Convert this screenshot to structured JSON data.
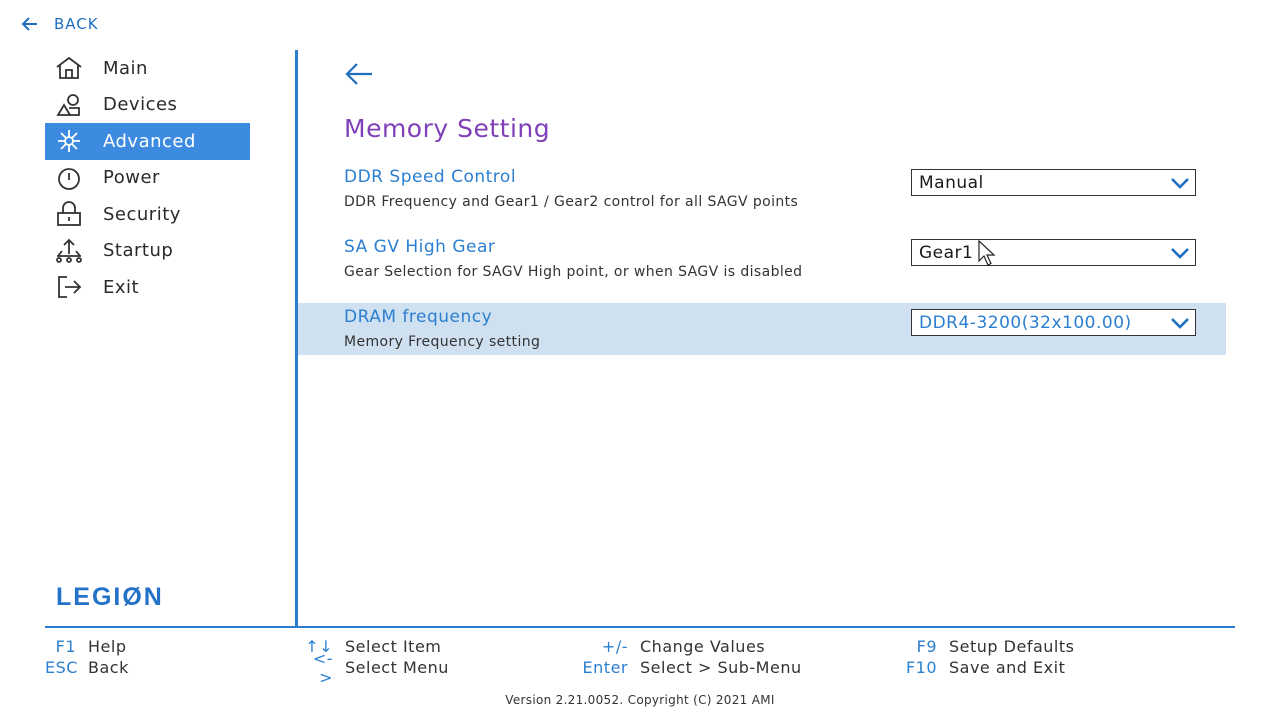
{
  "header": {
    "back_label": "BACK"
  },
  "sidebar": {
    "items": [
      {
        "label": "Main",
        "icon": "home-icon"
      },
      {
        "label": "Devices",
        "icon": "devices-icon"
      },
      {
        "label": "Advanced",
        "icon": "advanced-icon",
        "active": true
      },
      {
        "label": "Power",
        "icon": "power-icon"
      },
      {
        "label": "Security",
        "icon": "lock-icon"
      },
      {
        "label": "Startup",
        "icon": "startup-icon"
      },
      {
        "label": "Exit",
        "icon": "exit-icon"
      }
    ],
    "logo": "LEGIØN"
  },
  "main": {
    "title": "Memory Setting",
    "settings": [
      {
        "label": "DDR Speed Control",
        "description": "DDR Frequency and Gear1 / Gear2 control for all SAGV points",
        "value": "Manual"
      },
      {
        "label": "SA GV High Gear",
        "description": "Gear Selection for SAGV High point, or when SAGV is disabled",
        "value": "Gear1"
      },
      {
        "label": "DRAM frequency",
        "description": "Memory Frequency setting",
        "value": "DDR4-3200(32x100.00)",
        "selected": true
      }
    ]
  },
  "footer": {
    "keys": [
      {
        "key": "F1",
        "text": "Help"
      },
      {
        "key": "ESC",
        "text": "Back"
      },
      {
        "key": "↑↓",
        "text": "Select Item"
      },
      {
        "key": "<->",
        "text": "Select Menu"
      },
      {
        "key": "+/-",
        "text": "Change Values"
      },
      {
        "key": "Enter",
        "text": "Select > Sub-Menu"
      },
      {
        "key": "F9",
        "text": "Setup Defaults"
      },
      {
        "key": "F10",
        "text": "Save and Exit"
      }
    ],
    "version": "Version 2.21.0052. Copyright (C) 2021 AMI"
  },
  "colors": {
    "accent": "#2b7fd0",
    "active_nav_bg": "#3d8be0",
    "selected_row_bg": "#cfe1f0",
    "title": "#8040b8"
  }
}
